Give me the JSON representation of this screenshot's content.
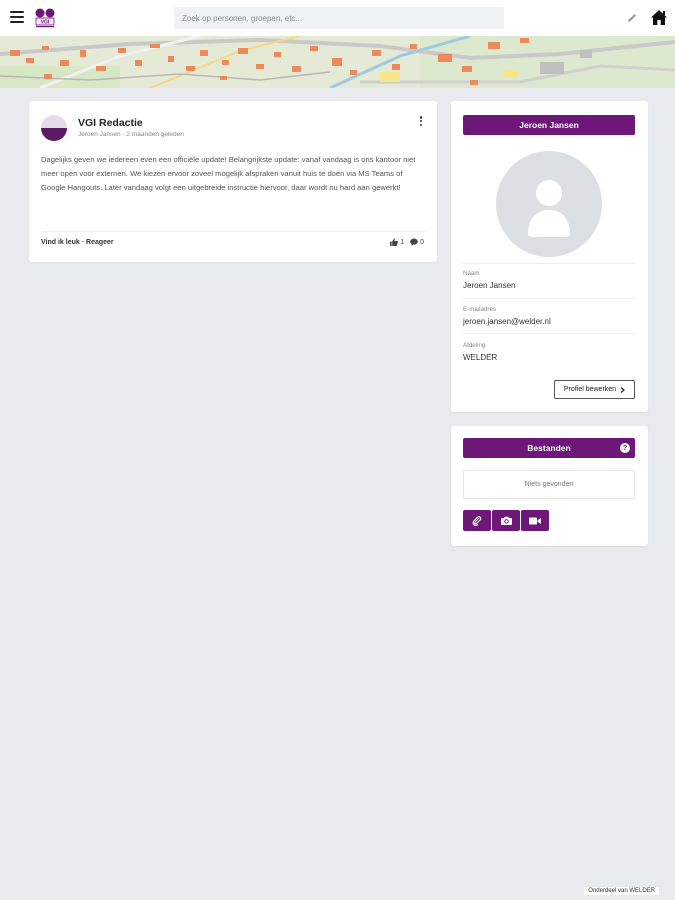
{
  "search": {
    "placeholder": "Zoek op personen, groepen, etc..."
  },
  "post": {
    "author": "VGI Redactie",
    "meta": "Jeroen Jansen - 2 maanden geleden",
    "body": "Dagelijks geven we iedereen even een officiële update! Belangrijkste update: vanaf vandaag is ons kantoor niet meer open voor externen. We kiezen ervoor zoveel mogelijk afspraken vanuit huis te doen via MS Teams of Google Hangouts. Later vandaag volgt een uitgebreide instructie hiervoor, daar wordt nu hard aan gewerkt!",
    "like_label": "Vind ik leuk",
    "separator": " - ",
    "reply_label": "Reageer",
    "likes": "1",
    "comments": "0"
  },
  "profile": {
    "title": "Jeroen Jansen",
    "fields": [
      {
        "label": "Naam",
        "value": "Jeroen Jansen"
      },
      {
        "label": "E-mailadres",
        "value": "jeroen.jansen@welder.nl"
      },
      {
        "label": "Afdeling",
        "value": "WELDER"
      }
    ],
    "edit_label": "Profiel bewerken"
  },
  "files": {
    "title": "Bestanden",
    "help": "?",
    "empty_text": "Niets gevonden",
    "tools": [
      "paperclip-icon",
      "camera-icon",
      "video-icon"
    ]
  },
  "footer": {
    "text": "Onderdeel van WELDER"
  },
  "colors": {
    "accent": "#6d1778",
    "background": "#e9eaed",
    "avatar": "#dcdfe3"
  }
}
